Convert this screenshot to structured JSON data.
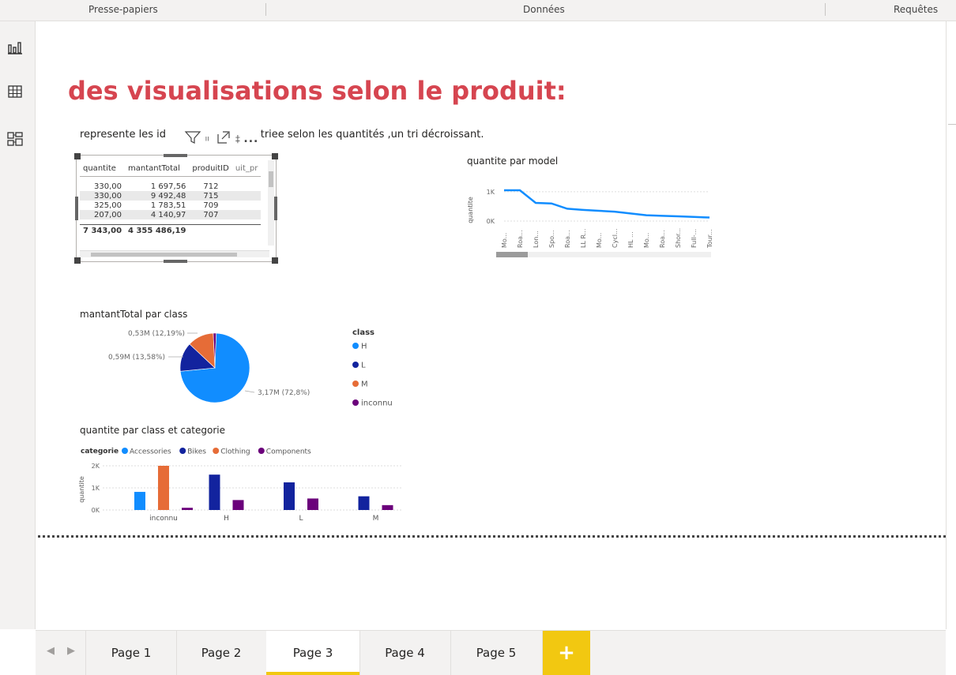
{
  "ribbon": {
    "groups": [
      "Presse-papiers",
      "Données",
      "Requêtes"
    ]
  },
  "left_nav": {
    "items": [
      {
        "icon": "report-view-icon"
      },
      {
        "icon": "data-view-icon"
      },
      {
        "icon": "model-view-icon"
      }
    ]
  },
  "page": {
    "title": "des visualisations selon le produit:",
    "subtitle_start": "represente les id",
    "subtitle_end": "luits triee selon les quantités  ,un tri décroissant."
  },
  "table_visual": {
    "columns": [
      "quantite",
      "mantantTotal",
      "produitID",
      "uit_pr"
    ],
    "rows": [
      [
        "330,00",
        "1 697,56",
        "712"
      ],
      [
        "330,00",
        "9 492,48",
        "715"
      ],
      [
        "325,00",
        "1 783,51",
        "709"
      ],
      [
        "207,00",
        "4 140,97",
        "707"
      ]
    ],
    "total": [
      "7 343,00",
      "4 355 486,19"
    ]
  },
  "visual_toolbar": {
    "filter_icon": "filter-icon",
    "focus_icon": "focus-mode-icon",
    "more_label": "..."
  },
  "line_chart": {
    "header": "quantite par model",
    "ylabel": "quantite",
    "yticks": [
      "1K",
      "0K"
    ],
    "xticks": [
      "Mo...",
      "Roa...",
      "Lon...",
      "Spo...",
      "Roa...",
      "LL R...",
      "Mo...",
      "Cycl...",
      "HL ...",
      "Mo...",
      "Roa...",
      "Shor...",
      "Full-...",
      "Tour..."
    ],
    "chart_data": {
      "type": "line",
      "x": [
        "Mo...",
        "Roa...",
        "Lon...",
        "Spo...",
        "Roa...",
        "LL R...",
        "Mo...",
        "Cycl...",
        "HL ...",
        "Mo...",
        "Roa...",
        "Shor...",
        "Full-...",
        "Tour..."
      ],
      "series": [
        {
          "values": [
            1050,
            1050,
            620,
            600,
            420,
            380,
            350,
            320,
            260,
            200,
            180,
            160,
            140,
            120
          ]
        }
      ],
      "ylim": [
        0,
        1400
      ],
      "color": "#118dff"
    }
  },
  "pie_chart": {
    "header": "mantantTotal par class",
    "legend_title": "class",
    "legend": [
      {
        "label": "H",
        "color": "#118dff"
      },
      {
        "label": "L",
        "color": "#12239e"
      },
      {
        "label": "M",
        "color": "#e66c37"
      },
      {
        "label": "inconnu",
        "color": "#6b007b"
      }
    ],
    "data_labels": [
      "0,53M (12,19%)",
      "0,59M (13,58%)",
      "3,17M (72,8%)"
    ],
    "chart_data": {
      "type": "pie",
      "categories": [
        "H",
        "L",
        "M",
        "inconnu"
      ],
      "values": [
        72.8,
        13.58,
        12.19,
        1.43
      ],
      "colors": [
        "#118dff",
        "#12239e",
        "#e66c37",
        "#6b007b"
      ]
    }
  },
  "bar_chart": {
    "header": "quantite par class et categorie",
    "legend_title": "categorie",
    "legend": [
      {
        "label": "Accessories",
        "color": "#118dff"
      },
      {
        "label": "Bikes",
        "color": "#12239e"
      },
      {
        "label": "Clothing",
        "color": "#e66c37"
      },
      {
        "label": "Components",
        "color": "#6b007b"
      }
    ],
    "ylabel": "quantite",
    "yticks": [
      "2K",
      "1K",
      "0K"
    ],
    "categories": [
      "inconnu",
      "H",
      "L",
      "M"
    ],
    "chart_data": {
      "type": "bar",
      "categories": [
        "inconnu",
        "H",
        "L",
        "M"
      ],
      "series": [
        {
          "name": "Accessories",
          "values": [
            820,
            0,
            0,
            0
          ]
        },
        {
          "name": "Bikes",
          "values": [
            0,
            1600,
            1250,
            620
          ]
        },
        {
          "name": "Clothing",
          "values": [
            2000,
            0,
            0,
            0
          ]
        },
        {
          "name": "Components",
          "values": [
            100,
            450,
            520,
            220
          ]
        }
      ],
      "ylim": [
        0,
        2000
      ]
    }
  },
  "tabs": {
    "items": [
      "Page 1",
      "Page 2",
      "Page 3",
      "Page 4",
      "Page 5"
    ],
    "active": "Page 3",
    "add_label": "+"
  }
}
